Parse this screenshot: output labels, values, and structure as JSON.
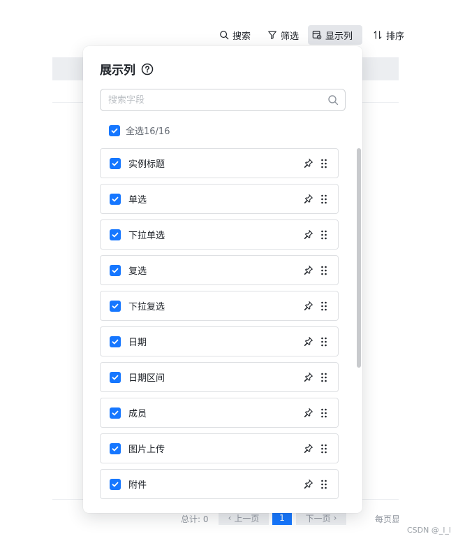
{
  "toolbar": {
    "search_label": "搜索",
    "filter_label": "筛选",
    "columns_label": "显示列",
    "sort_label": "排序"
  },
  "popover": {
    "title": "展示列",
    "search_placeholder": "搜索字段",
    "select_all_label": "全选16/16",
    "items": [
      {
        "label": "实例标题"
      },
      {
        "label": "单选"
      },
      {
        "label": "下拉单选"
      },
      {
        "label": "复选"
      },
      {
        "label": "下拉复选"
      },
      {
        "label": "日期"
      },
      {
        "label": "日期区间"
      },
      {
        "label": "成员"
      },
      {
        "label": "图片上传"
      },
      {
        "label": "附件"
      }
    ]
  },
  "pagination": {
    "total": "总计: 0",
    "prev_label": "上一页",
    "current_page": "1",
    "next_label": "下一页",
    "page_size_label": "每页显示"
  },
  "watermark": "CSDN @_l_l",
  "colors": {
    "accent": "#1677ff",
    "active_tab_bg": "#e4e6ea",
    "border": "#dee0e3"
  }
}
